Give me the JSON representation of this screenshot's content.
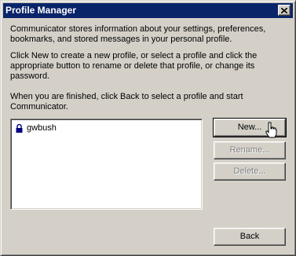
{
  "window": {
    "title": "Profile Manager",
    "close_glyph": "✕"
  },
  "body": {
    "intro_text": "Communicator stores information about your settings, preferences, bookmarks, and stored messages in your personal profile.",
    "instructions_text": "Click New to create a new profile, or select a profile and click the appropriate button to rename or delete that profile, or change its password.",
    "finish_text": "When you are finished, click Back to select a profile and start Communicator."
  },
  "profiles": {
    "items": [
      {
        "label": "gwbush",
        "icon": "lock-icon"
      }
    ]
  },
  "buttons": {
    "new_label": "New...",
    "rename_label": "Rename...",
    "delete_label": "Delete...",
    "back_label": "Back"
  },
  "colors": {
    "face": "#d4d0c8",
    "titlebar": "#0a246a",
    "disabled_text": "#808080"
  }
}
